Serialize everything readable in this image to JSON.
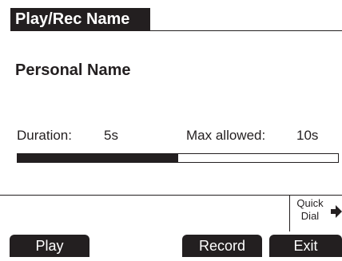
{
  "header": {
    "title": "Play/Rec Name"
  },
  "main": {
    "heading": "Personal Name",
    "duration_label": "Duration:",
    "duration_value": "5s",
    "max_label": "Max allowed:",
    "max_value": "10s",
    "progress_fraction": 0.5
  },
  "quick_dial": {
    "line1": "Quick",
    "line2": "Dial",
    "icon": "arrow-right-icon"
  },
  "softkeys": {
    "play": "Play",
    "record": "Record",
    "exit": "Exit"
  },
  "colors": {
    "foreground": "#231f20",
    "background": "#ffffff"
  }
}
